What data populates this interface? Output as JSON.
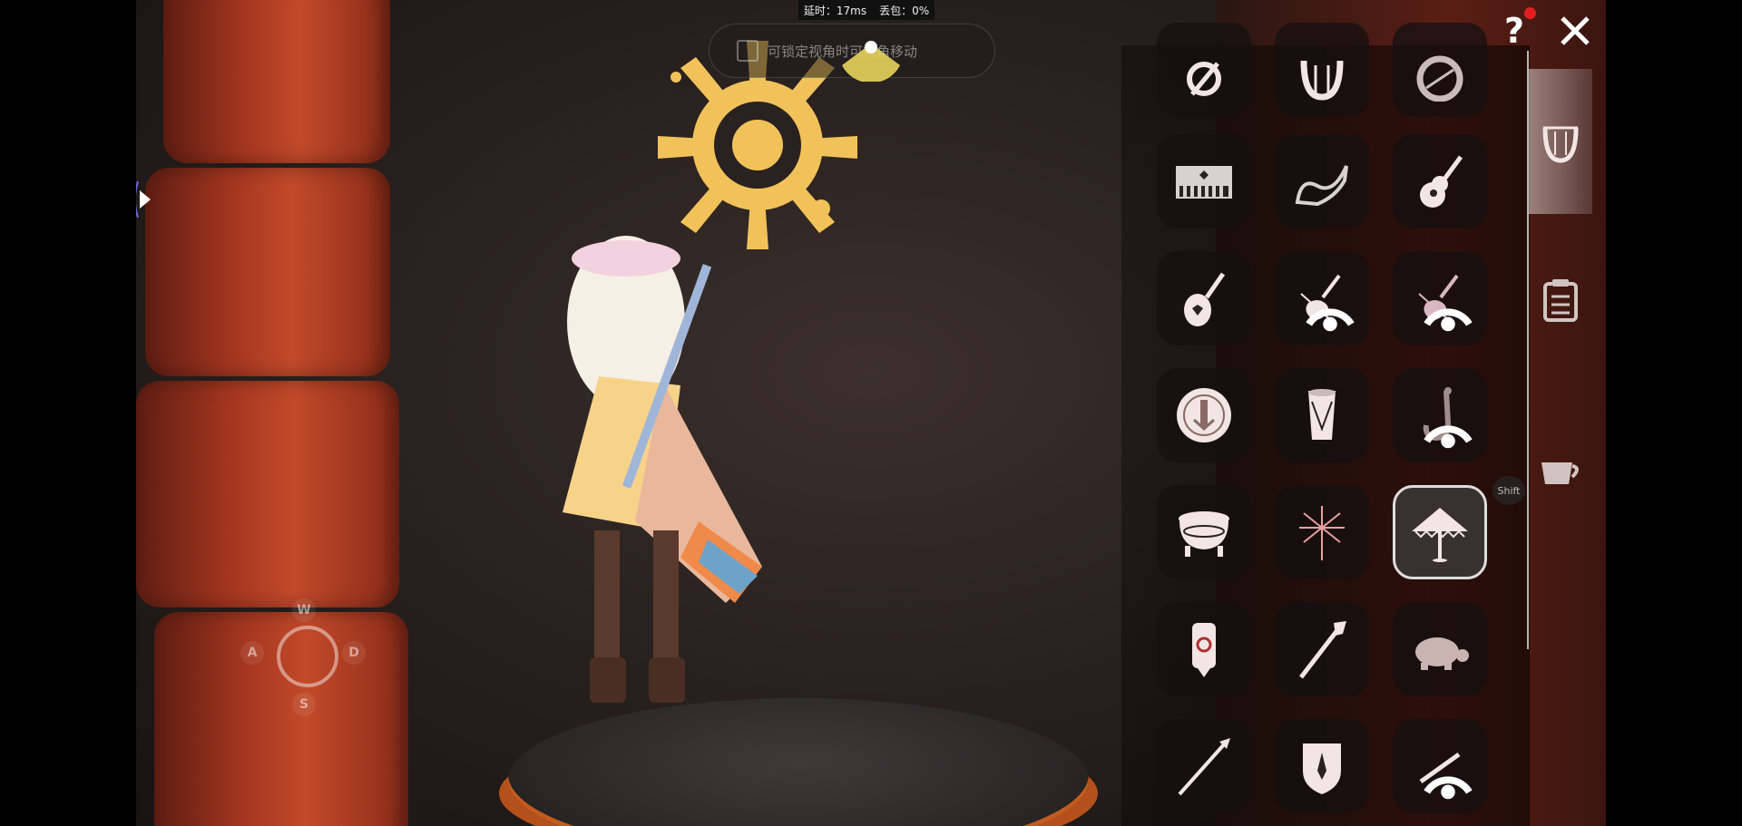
{
  "hud": {
    "latency_label": "延时：17ms",
    "packet_loss_label": "丢包：0%",
    "lock_hint": "可锁定视角时可视角移动"
  },
  "joystick": {
    "up": "W",
    "left": "A",
    "right": "D",
    "down": "S"
  },
  "panel": {
    "shift_key": "Shift",
    "help_label": "?",
    "instruments": [
      "generic-round-icon",
      "harp-icon",
      "drum-round-icon",
      "kalimba-icon",
      "horn-icon",
      "guitar-icon",
      "lute-icon",
      "violin-icon",
      "cello-icon",
      "handpan-icon",
      "hand-drum-icon",
      "saxophone-icon",
      "cauldron-drum-icon",
      "firework-icon",
      "umbrella-icon",
      "lantern-icon",
      "staff-icon",
      "turtle-icon",
      "spear-icon",
      "shield-icon",
      "flute-icon"
    ],
    "selected_instrument": "umbrella-icon",
    "tabs": [
      "harp-tab-icon",
      "clipboard-tab-icon",
      "cup-tab-icon"
    ]
  },
  "colors": {
    "sun": "#f2c25a",
    "panel_icon": "#f1e6e4",
    "pillar": "#a3361f"
  }
}
